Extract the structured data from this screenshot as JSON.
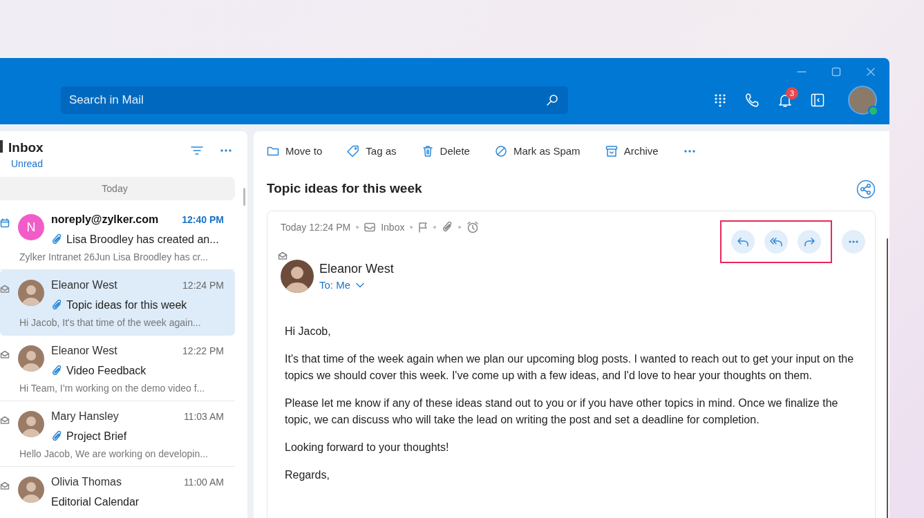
{
  "header": {
    "search_placeholder": "Search in Mail",
    "notification_count": "3"
  },
  "mail_list": {
    "title": "Inbox",
    "filter": "Unread",
    "group": "Today",
    "items": [
      {
        "kind": "calendar",
        "initial": "N",
        "color": "#f25cc8",
        "sender": "noreply@zylker.com",
        "time": "12:40 PM",
        "subject": "Lisa Broodley has created an...",
        "preview": "Zylker Intranet 26Jun Lisa Broodley has cr...",
        "attachment": true,
        "unread": true,
        "selected": false
      },
      {
        "kind": "mail",
        "sender": "Eleanor West",
        "time": "12:24 PM",
        "subject": "Topic ideas for this week",
        "preview": "Hi Jacob, It's that time of the week again...",
        "attachment": true,
        "unread": false,
        "selected": true
      },
      {
        "kind": "mail",
        "sender": "Eleanor West",
        "time": "12:22 PM",
        "subject": "Video Feedback",
        "preview": "Hi Team, I’m working on the demo video f...",
        "attachment": true,
        "unread": false,
        "selected": false
      },
      {
        "kind": "mail",
        "sender": "Mary Hansley",
        "time": "11:03 AM",
        "subject": "Project Brief",
        "preview": "Hello Jacob, We are working on developin...",
        "attachment": true,
        "unread": false,
        "selected": false
      },
      {
        "kind": "mail",
        "sender": "Olivia Thomas",
        "time": "11:00 AM",
        "subject": "Editorial Calendar",
        "unread": false,
        "selected": false
      }
    ]
  },
  "toolbar": [
    {
      "kind": "move",
      "label": "Move to"
    },
    {
      "kind": "tag",
      "label": "Tag as"
    },
    {
      "kind": "delete",
      "label": "Delete"
    },
    {
      "kind": "spam",
      "label": "Mark as Spam"
    },
    {
      "kind": "archive",
      "label": "Archive"
    }
  ],
  "message": {
    "subject": "Topic ideas for this week",
    "date": "Today 12:24 PM",
    "folder": "Inbox",
    "sender": "Eleanor West",
    "to": "To: Me",
    "reply_actions_highlighted": true,
    "body": [
      "Hi Jacob,",
      "It's that time of the week again when we plan our upcoming blog posts. I wanted to reach out to get your input on the topics we should cover this week. I've come up with a few ideas, and I'd love to hear your thoughts on them.",
      "Please let me know if any of these ideas stand out to you or if you have other topics in mind. Once we finalize the topic, we can discuss who will take the lead on writing the post and set a deadline for completion.",
      "Looking forward to your thoughts!",
      "Regards,"
    ]
  }
}
